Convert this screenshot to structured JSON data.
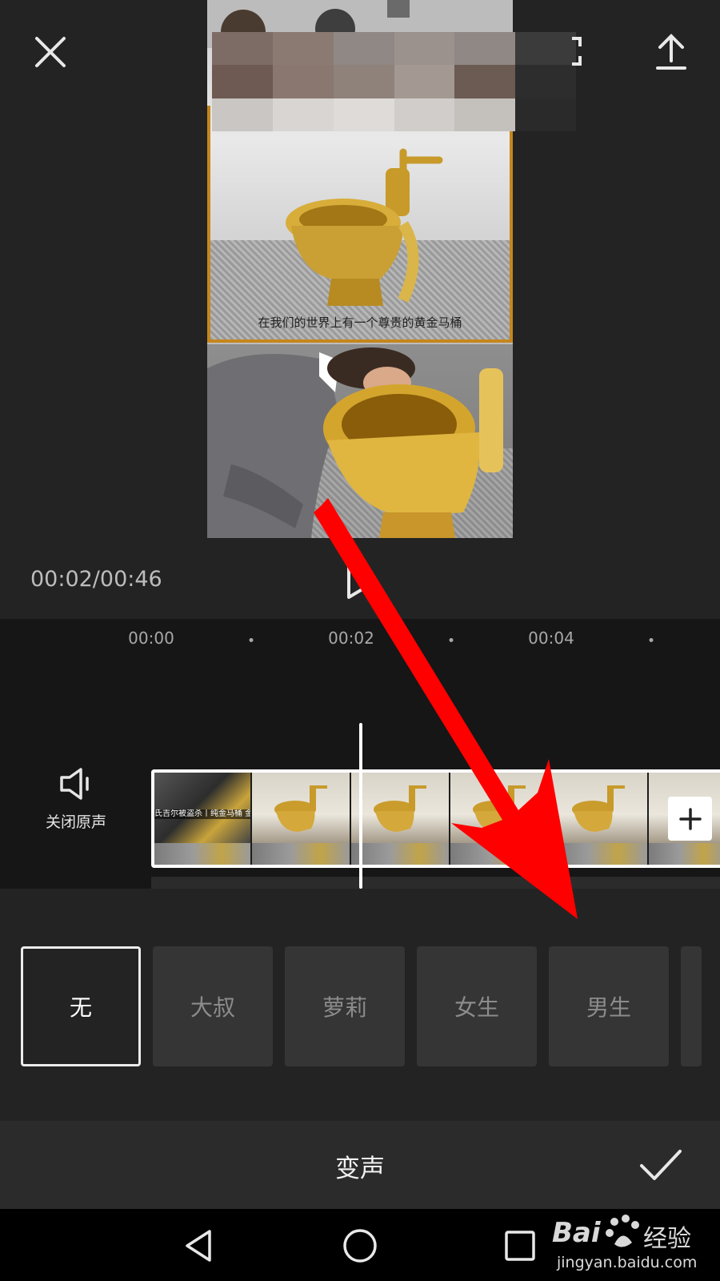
{
  "preview": {
    "subtitle": "在我们的世界上有一个尊贵的黄金马桶",
    "time_display": "00:02/00:46"
  },
  "icons": {
    "close": "close-icon",
    "fullscreen": "fullscreen-icon",
    "export": "upload-icon",
    "play": "play-icon",
    "speaker": "speaker-icon",
    "add": "plus-icon",
    "confirm": "check-icon"
  },
  "timeline": {
    "ruler_labels": [
      "00:00",
      "00:02",
      "00:04"
    ],
    "mute_label": "关闭原声",
    "first_clip_caption": "氏吉尔被盗杀丨纯金马桶 金马桶的造价叫“美国”"
  },
  "voice_effects": {
    "options": [
      "无",
      "大叔",
      "萝莉",
      "女生",
      "男生"
    ],
    "selected": "无"
  },
  "bottom_bar": {
    "title": "变声"
  },
  "watermark": {
    "brand": "Bai",
    "brand_suffix": "经验",
    "url": "jingyan.baidu.com"
  },
  "colors": {
    "background": "#232323",
    "timeline_bg": "#161616",
    "effect_tile": "#353535",
    "selected_border": "#ececec",
    "annotation_arrow": "#ff0000",
    "gold": "#c6861c"
  }
}
